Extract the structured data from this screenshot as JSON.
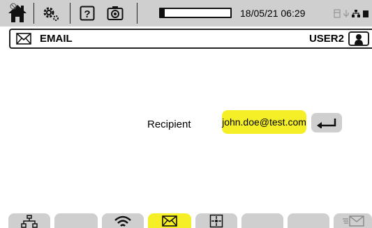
{
  "status_bar": {
    "datetime": "18/05/21 06:29",
    "progress_fraction": 0.06,
    "icons": [
      "home-icon",
      "gear-icon",
      "help-icon",
      "camera-icon",
      "storage-icon",
      "usb-icon",
      "network-icon",
      "battery-icon"
    ],
    "help_label": "?"
  },
  "title_bar": {
    "title": "EMAIL",
    "user": "USER2",
    "icons": [
      "envelope-icon",
      "user-icon"
    ]
  },
  "form": {
    "recipient_label": "Recipient",
    "recipient_value": "john.doe@test.com"
  },
  "tabs": [
    {
      "icon": "network-icon",
      "active": false
    },
    {
      "icon": "",
      "active": false
    },
    {
      "icon": "wifi-icon",
      "active": false
    },
    {
      "icon": "envelope-icon",
      "active": true
    },
    {
      "icon": "target-icon",
      "active": false
    },
    {
      "icon": "",
      "active": false
    },
    {
      "icon": "",
      "active": false
    },
    {
      "icon": "send-mail-icon",
      "active": false
    }
  ],
  "colors": {
    "accent_yellow": "#f5ef28",
    "bar_gray": "#cfcfcf",
    "text": "#000000"
  }
}
